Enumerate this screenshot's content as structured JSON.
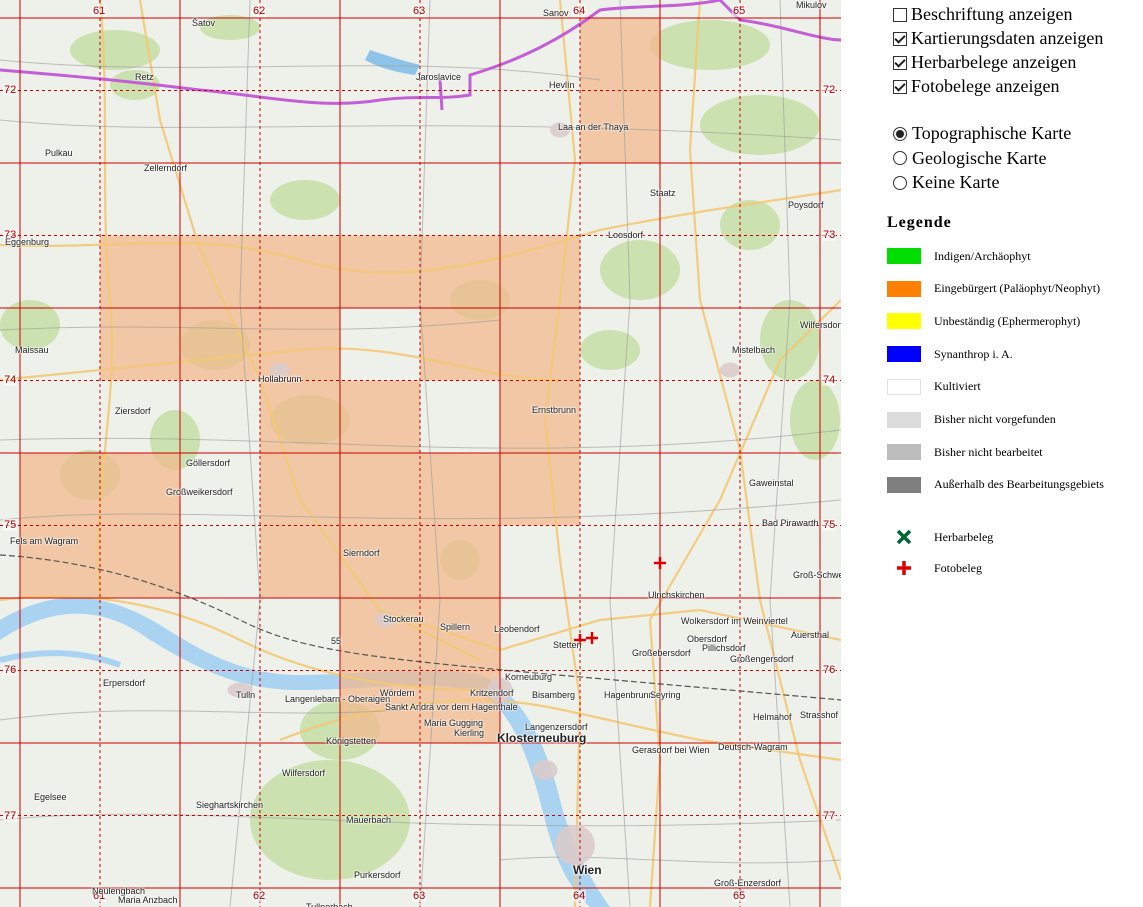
{
  "map": {
    "grid_cols": [
      {
        "label": "61"
      },
      {
        "label": "62"
      },
      {
        "label": "63"
      },
      {
        "label": "64"
      },
      {
        "label": "65"
      }
    ],
    "grid_rows": [
      {
        "label": "72"
      },
      {
        "label": "73"
      },
      {
        "label": "74"
      },
      {
        "label": "75"
      },
      {
        "label": "76"
      },
      {
        "label": "77"
      }
    ],
    "places": [
      {
        "name": "Šatov"
      },
      {
        "name": "Sanov"
      },
      {
        "name": "Mikulov"
      },
      {
        "name": "Retz"
      },
      {
        "name": "Jaroslavice"
      },
      {
        "name": "Hevlín"
      },
      {
        "name": "Laa an der Thaya"
      },
      {
        "name": "Pulkau"
      },
      {
        "name": "Zellerndorf"
      },
      {
        "name": "Staatz"
      },
      {
        "name": "Poysdorf"
      },
      {
        "name": "Eggenburg"
      },
      {
        "name": "Loosdorf"
      },
      {
        "name": "Wilfersdorf"
      },
      {
        "name": "Maissau"
      },
      {
        "name": "Hollabrunn"
      },
      {
        "name": "Mistelbach"
      },
      {
        "name": "Ernstbrunn"
      },
      {
        "name": "Ziersdorf"
      },
      {
        "name": "Göllersdorf"
      },
      {
        "name": "Großweikersdorf"
      },
      {
        "name": "Gaweinstal"
      },
      {
        "name": "Bad Pirawarth"
      },
      {
        "name": "Fels am Wagram"
      },
      {
        "name": "Sierndorf"
      },
      {
        "name": "Groß-Schweinbarth"
      },
      {
        "name": "Ulrichskirchen"
      },
      {
        "name": "Stockerau"
      },
      {
        "name": "Spillern"
      },
      {
        "name": "Leobendorf"
      },
      {
        "name": "Wolkersdorf im Weinviertel"
      },
      {
        "name": "Auersthal"
      },
      {
        "name": "Stetten"
      },
      {
        "name": "Großebersdorf"
      },
      {
        "name": "Obersdorf"
      },
      {
        "name": "Pillichsdorf"
      },
      {
        "name": "Großengersdorf"
      },
      {
        "name": "Erpersdorf"
      },
      {
        "name": "Korneuburg"
      },
      {
        "name": "Tulln"
      },
      {
        "name": "Langenlebarn - Oberaigen"
      },
      {
        "name": "Wördern"
      },
      {
        "name": "Kritzendorf"
      },
      {
        "name": "Bisamberg"
      },
      {
        "name": "Hagenbrunn"
      },
      {
        "name": "Seyring"
      },
      {
        "name": "Sankt Andrä vor dem Hagenthale"
      },
      {
        "name": "Maria Gugging"
      },
      {
        "name": "Kierling"
      },
      {
        "name": "Langenzersdorf"
      },
      {
        "name": "Helmahof"
      },
      {
        "name": "Strasshof an der"
      },
      {
        "name": "Königstetten"
      },
      {
        "name": "Klosterneuburg"
      },
      {
        "name": "Gerasdorf bei Wien"
      },
      {
        "name": "Deutsch-Wagram"
      },
      {
        "name": "Wilfersdorf"
      },
      {
        "name": "Egelsee"
      },
      {
        "name": "Sieghartskirchen"
      },
      {
        "name": "Mauerbach"
      },
      {
        "name": "Purkersdorf"
      },
      {
        "name": "Wien"
      },
      {
        "name": "Groß-Enzersdorf"
      },
      {
        "name": "Neulengbach"
      },
      {
        "name": "Maria Anzbach"
      },
      {
        "name": "Tullnerbach"
      },
      {
        "name": "55"
      }
    ],
    "highlight_color": "#f2b78a",
    "grid_color": "#cc0000"
  },
  "options": {
    "checkboxes": [
      {
        "label": "Beschriftung anzeigen",
        "checked": false
      },
      {
        "label": "Kartierungsdaten anzeigen",
        "checked": true
      },
      {
        "label": "Herbarbelege anzeigen",
        "checked": true
      },
      {
        "label": "Fotobelege anzeigen",
        "checked": true
      }
    ],
    "radios": [
      {
        "label": "Topographische Karte",
        "checked": true
      },
      {
        "label": "Geologische Karte",
        "checked": false
      },
      {
        "label": "Keine Karte",
        "checked": false
      }
    ]
  },
  "legend": {
    "title": "Legende",
    "items": [
      {
        "label": "Indigen/Archäophyt",
        "color": "#00dd00"
      },
      {
        "label": "Eingebürgert (Paläophyt/Neophyt)",
        "color": "#ff7f00"
      },
      {
        "label": "Unbeständig (Ephermerophyt)",
        "color": "#ffff00"
      },
      {
        "label": "Synanthrop i. A.",
        "color": "#0000ff"
      },
      {
        "label": "Kultiviert",
        "color": "#ffffff"
      },
      {
        "label": "Bisher nicht vorgefunden",
        "color": "#dcdcdc"
      },
      {
        "label": "Bisher nicht bearbeitet",
        "color": "#bcbcbc"
      },
      {
        "label": "Außerhalb des Bearbeitungsgebiets",
        "color": "#7f7f7f"
      }
    ],
    "symbols": [
      {
        "label": "Herbarbeleg",
        "icon": "x-mark-icon",
        "color": "#006633"
      },
      {
        "label": "Fotobeleg",
        "icon": "plus-mark-icon",
        "color": "#dd0000"
      }
    ]
  }
}
